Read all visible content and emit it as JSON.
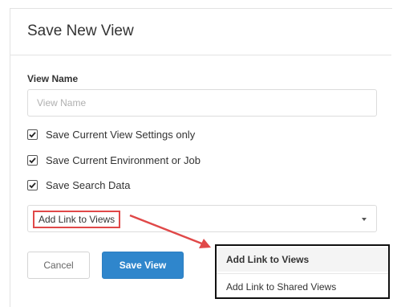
{
  "dialog": {
    "title": "Save New View",
    "view_name_label": "View Name",
    "view_name_placeholder": "View Name",
    "view_name_value": "",
    "options": [
      {
        "label": "Save Current View Settings only",
        "checked": true
      },
      {
        "label": "Save Current Environment or Job",
        "checked": true
      },
      {
        "label": "Save Search Data",
        "checked": true
      }
    ],
    "link_select": {
      "selected": "Add Link to Views"
    },
    "buttons": {
      "cancel": "Cancel",
      "save": "Save View"
    }
  },
  "dropdown_menu": {
    "items": [
      {
        "label": "Add Link to Views",
        "highlighted": true
      },
      {
        "label": "Add Link to Shared Views",
        "highlighted": false
      }
    ]
  },
  "colors": {
    "primary": "#2f86cc",
    "annotation_red": "#e04848",
    "callout_border": "#111111"
  }
}
